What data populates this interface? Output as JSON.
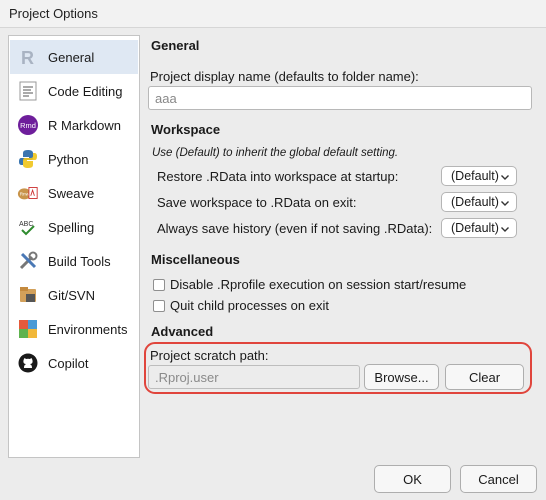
{
  "window": {
    "title": "Project Options"
  },
  "sidebar": {
    "items": [
      {
        "label": "General",
        "icon": "r-icon"
      },
      {
        "label": "Code Editing",
        "icon": "code-editing-icon"
      },
      {
        "label": "R Markdown",
        "icon": "rmd-icon"
      },
      {
        "label": "Python",
        "icon": "python-icon"
      },
      {
        "label": "Sweave",
        "icon": "sweave-icon"
      },
      {
        "label": "Spelling",
        "icon": "spelling-icon"
      },
      {
        "label": "Build Tools",
        "icon": "build-tools-icon"
      },
      {
        "label": "Git/SVN",
        "icon": "git-icon"
      },
      {
        "label": "Environments",
        "icon": "environments-icon"
      },
      {
        "label": "Copilot",
        "icon": "github-icon"
      }
    ]
  },
  "general": {
    "title": "General",
    "display_name_label": "Project display name (defaults to folder name):",
    "display_name_value": "aaa"
  },
  "workspace": {
    "title": "Workspace",
    "note": "Use (Default) to inherit the global default setting.",
    "restore_label": "Restore .RData into workspace at startup:",
    "restore_value": "(Default)",
    "save_label": "Save workspace to .RData on exit:",
    "save_value": "(Default)",
    "history_label": "Always save history (even if not saving .RData):",
    "history_value": "(Default)"
  },
  "misc": {
    "title": "Miscellaneous",
    "disable_rprofile_label": "Disable .Rprofile execution on session start/resume",
    "quit_child_label": "Quit child processes on exit"
  },
  "advanced": {
    "title": "Advanced",
    "scratch_label": "Project scratch path:",
    "scratch_placeholder": ".Rproj.user",
    "browse_label": "Browse...",
    "clear_label": "Clear"
  },
  "footer": {
    "ok_label": "OK",
    "cancel_label": "Cancel"
  },
  "colors": {
    "highlight": "#e0453c",
    "selected_item": "#dfe8f3"
  }
}
